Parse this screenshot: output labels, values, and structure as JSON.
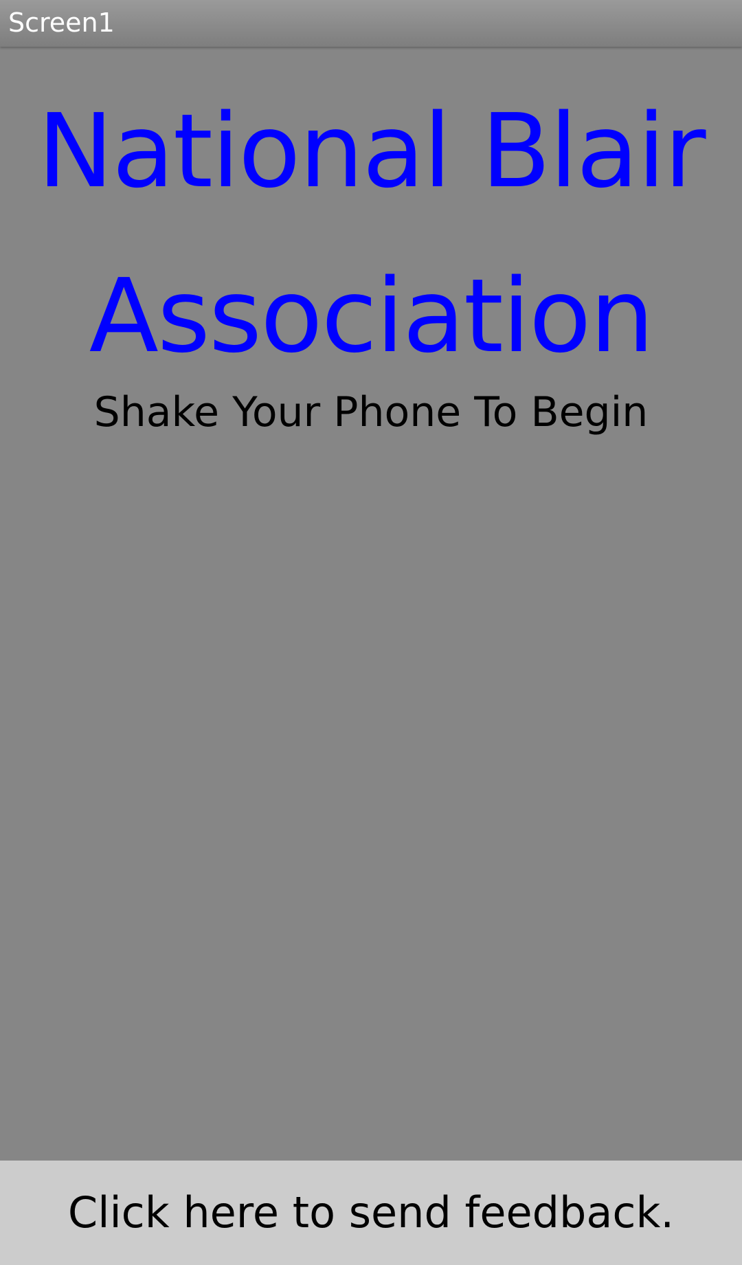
{
  "title_bar": {
    "title": "Screen1"
  },
  "main": {
    "heading": "National Blair Association",
    "subheading": "Shake Your Phone To Begin"
  },
  "feedback": {
    "label": "Click here to send feedback."
  },
  "colors": {
    "background": "#868686",
    "heading": "#0000ff",
    "feedback_bar": "#cccccc"
  }
}
